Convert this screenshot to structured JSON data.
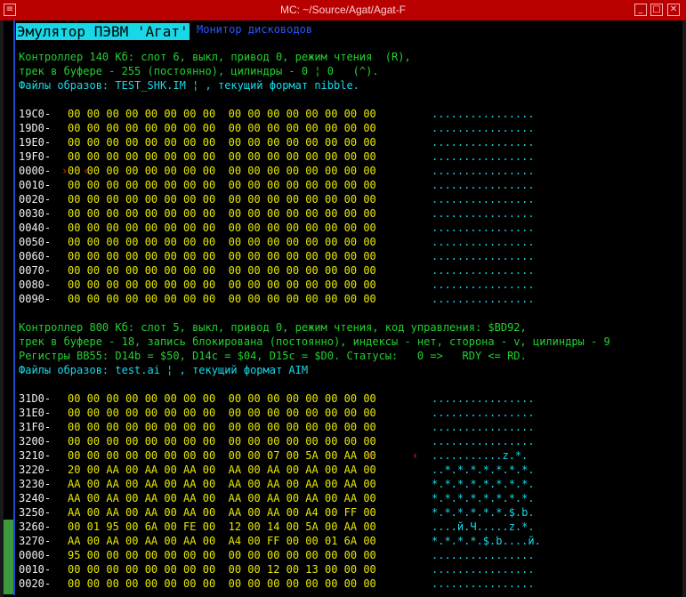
{
  "window": {
    "title": "MC: ~/Source/Agat/Agat-F"
  },
  "menu": {
    "active": "Эмулятор ПЭВМ 'Агат'",
    "second": "Монитор дисководов"
  },
  "ctrl140": {
    "line1": "Контроллер 140 Кб: слот 6, выкл, привод 0, режим чтения  (R),",
    "line2": "трек в буфере - 255 (постоянно), цилиндры - 0 ¦ 0   (^).",
    "line3": "Файлы образов: TEST_SHK.IM ¦ , текущий формат nibble."
  },
  "dump1": [
    {
      "a": "19C0-",
      "h": "00 00 00 00 00 00 00 00  00 00 00 00 00 00 00 00",
      "t": "................"
    },
    {
      "a": "19D0-",
      "h": "00 00 00 00 00 00 00 00  00 00 00 00 00 00 00 00",
      "t": "................"
    },
    {
      "a": "19E0-",
      "h": "00 00 00 00 00 00 00 00  00 00 00 00 00 00 00 00",
      "t": "................"
    },
    {
      "a": "19F0-",
      "h": "00 00 00 00 00 00 00 00  00 00 00 00 00 00 00 00",
      "t": "................"
    },
    {
      "a": "0000-",
      "h": "00 00 00 00 00 00 00 00  00 00 00 00 00 00 00 00",
      "t": "................"
    },
    {
      "a": "0010-",
      "h": "00 00 00 00 00 00 00 00  00 00 00 00 00 00 00 00",
      "t": "................"
    },
    {
      "a": "0020-",
      "h": "00 00 00 00 00 00 00 00  00 00 00 00 00 00 00 00",
      "t": "................"
    },
    {
      "a": "0030-",
      "h": "00 00 00 00 00 00 00 00  00 00 00 00 00 00 00 00",
      "t": "................"
    },
    {
      "a": "0040-",
      "h": "00 00 00 00 00 00 00 00  00 00 00 00 00 00 00 00",
      "t": "................"
    },
    {
      "a": "0050-",
      "h": "00 00 00 00 00 00 00 00  00 00 00 00 00 00 00 00",
      "t": "................"
    },
    {
      "a": "0060-",
      "h": "00 00 00 00 00 00 00 00  00 00 00 00 00 00 00 00",
      "t": "................"
    },
    {
      "a": "0070-",
      "h": "00 00 00 00 00 00 00 00  00 00 00 00 00 00 00 00",
      "t": "................"
    },
    {
      "a": "0080-",
      "h": "00 00 00 00 00 00 00 00  00 00 00 00 00 00 00 00",
      "t": "................"
    },
    {
      "a": "0090-",
      "h": "00 00 00 00 00 00 00 00  00 00 00 00 00 00 00 00",
      "t": "................"
    }
  ],
  "ctrl800": {
    "line1": "Контроллер 800 Кб: слот 5, выкл, привод 0, режим чтения, код управления: $BD92,",
    "line2": "трек в буфере - 18, запись блокирована (постоянно), индексы - нет, сторона - v, цилиндры - 9",
    "line3": "Регистры ВВ55: D14b = $50, D14c = $04, D15c = $D0. Статусы:   0 =>   RDY <= RD.",
    "line4": "Файлы образов: test.ai ¦ , текущий формат AIM"
  },
  "dump2": [
    {
      "a": "31D0-",
      "h": "00 00 00 00 00 00 00 00  00 00 00 00 00 00 00 00",
      "t": "................"
    },
    {
      "a": "31E0-",
      "h": "00 00 00 00 00 00 00 00  00 00 00 00 00 00 00 00",
      "t": "................"
    },
    {
      "a": "31F0-",
      "h": "00 00 00 00 00 00 00 00  00 00 00 00 00 00 00 00",
      "t": "................"
    },
    {
      "a": "3200-",
      "h": "00 00 00 00 00 00 00 00  00 00 00 00 00 00 00 00",
      "t": "................"
    },
    {
      "a": "3210-",
      "h": "00 00 00 00 00 00 00 00  00 00 07 00 5A 00 AA 00",
      "t": "...........z.*."
    },
    {
      "a": "3220-",
      "h": "20 00 AA 00 AA 00 AA 00  AA 00 AA 00 AA 00 AA 00",
      "t": "..*.*.*.*.*.*.*."
    },
    {
      "a": "3230-",
      "h": "AA 00 AA 00 AA 00 AA 00  AA 00 AA 00 AA 00 AA 00",
      "t": "*.*.*.*.*.*.*.*."
    },
    {
      "a": "3240-",
      "h": "AA 00 AA 00 AA 00 AA 00  AA 00 AA 00 AA 00 AA 00",
      "t": "*.*.*.*.*.*.*.*."
    },
    {
      "a": "3250-",
      "h": "AA 00 AA 00 AA 00 AA 00  AA 00 AA 00 A4 00 FF 00",
      "t": "*.*.*.*.*.*.$.b."
    },
    {
      "a": "3260-",
      "h": "00 01 95 00 6A 00 FE 00  12 00 14 00 5A 00 AA 00",
      "t": "....й.Ч.....z.*."
    },
    {
      "a": "3270-",
      "h": "AA 00 AA 00 AA 00 AA 00  A4 00 FF 00 00 01 6A 00",
      "t": "*.*.*.*.$.b....й."
    },
    {
      "a": "0000-",
      "h": "95 00 00 00 00 00 00 00  00 00 00 00 00 00 00 00",
      "t": "................"
    },
    {
      "a": "0010-",
      "h": "00 00 00 00 00 00 00 00  00 00 12 00 13 00 00 00",
      "t": "................"
    },
    {
      "a": "0020-",
      "h": "00 00 00 00 00 00 00 00  00 00 00 00 00 00 00 00",
      "t": "................"
    }
  ],
  "markers": {
    "left": "›",
    "right": "‹"
  },
  "colors": {
    "titlebar": "#b80000",
    "address": "#f0f0f0",
    "hex": "#e8e800",
    "ascii": "#18d8e8",
    "status": "#22d030",
    "files": "#18d8e8",
    "cursor": "#ff2020"
  }
}
